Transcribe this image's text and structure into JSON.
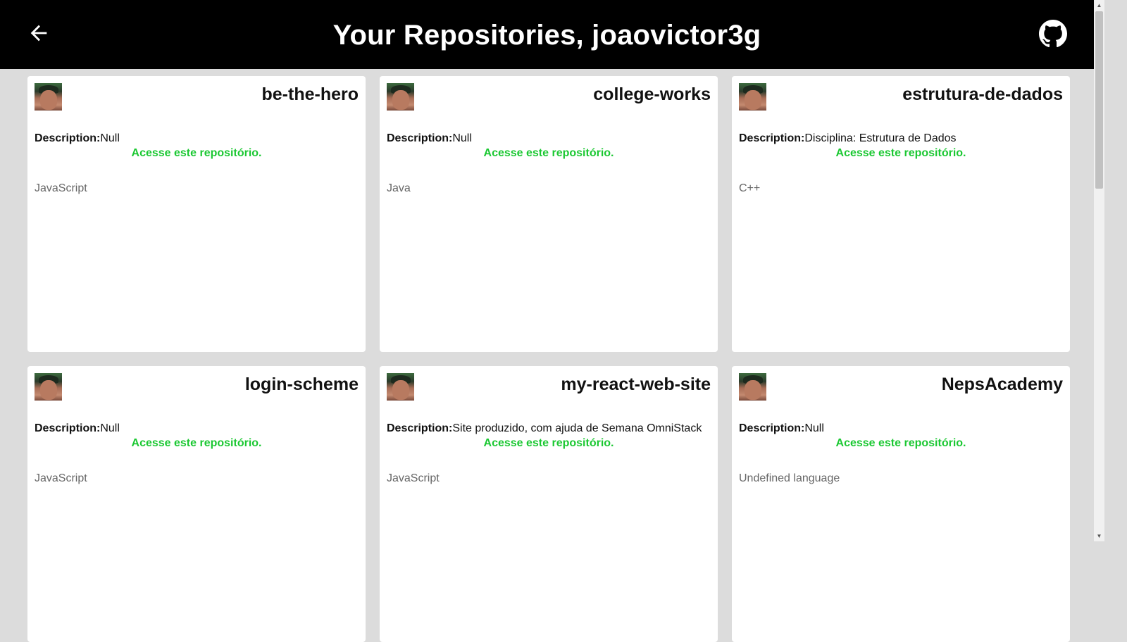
{
  "header": {
    "title": "Your Repositories, joaovictor3g",
    "back_icon": "arrow-left-icon",
    "github_icon": "github-icon",
    "background": "#000000"
  },
  "repos": [
    {
      "name": "be-the-hero",
      "description_label": "Description:",
      "description": "Null",
      "link": "Acesse este repositório.",
      "language": "JavaScript"
    },
    {
      "name": "college-works",
      "description_label": "Description:",
      "description": "Null",
      "link": "Acesse este repositório.",
      "language": "Java"
    },
    {
      "name": "estrutura-de-dados",
      "description_label": "Description:",
      "description": "Disciplina: Estrutura de Dados",
      "link": "Acesse este repositório.",
      "language": "C++"
    },
    {
      "name": "login-scheme",
      "description_label": "Description:",
      "description": "Null",
      "link": "Acesse este repositório.",
      "language": "JavaScript"
    },
    {
      "name": "my-react-web-site",
      "description_label": "Description:",
      "description": "Site produzido, com ajuda de Semana OmniStack",
      "link": "Acesse este repositório.",
      "language": "JavaScript"
    },
    {
      "name": "NepsAcademy",
      "description_label": "Description:",
      "description": "Null",
      "link": "Acesse este repositório.",
      "language": "Undefined language"
    }
  ],
  "colors": {
    "link": "#1bc832",
    "page_bg": "#dcdcdc",
    "card_bg": "#ffffff"
  }
}
